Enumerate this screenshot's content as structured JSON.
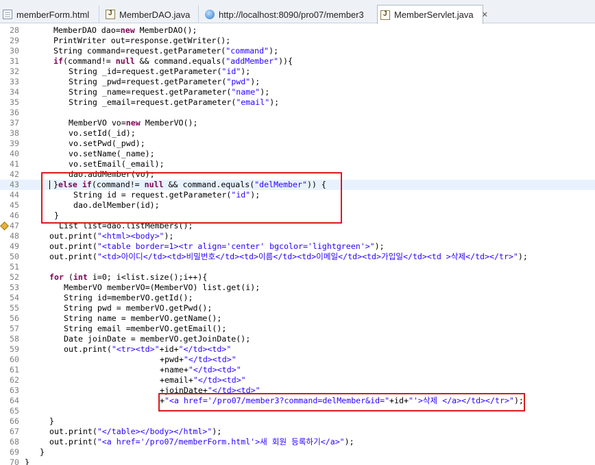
{
  "tabs": [
    {
      "label": "memberForm.html",
      "icon": "html-file-icon"
    },
    {
      "label": "MemberDAO.java",
      "icon": "java-file-icon"
    },
    {
      "label": "http://localhost:8090/pro07/member3",
      "icon": "web-browser-icon"
    },
    {
      "label": "MemberServlet.java",
      "icon": "java-file-icon",
      "active": true,
      "close": "✕"
    }
  ],
  "code_lines": [
    {
      "num": "28",
      "indent": 78,
      "tokens": [
        [
          "MemberDAO dao=",
          ""
        ],
        [
          "new",
          "kw"
        ],
        [
          " MemberDAO();",
          ""
        ]
      ]
    },
    {
      "num": "29",
      "indent": 78,
      "tokens": [
        [
          "PrintWriter out=response.getWriter();",
          ""
        ]
      ]
    },
    {
      "num": "30",
      "indent": 78,
      "tokens": [
        [
          "String command=request.getParameter(",
          ""
        ],
        [
          "\"command\"",
          "str"
        ],
        [
          ");",
          ""
        ]
      ]
    },
    {
      "num": "31",
      "indent": 78,
      "tokens": [
        [
          "if",
          "kw"
        ],
        [
          "(command!= ",
          ""
        ],
        [
          "null",
          "kw"
        ],
        [
          " && command.equals(",
          ""
        ],
        [
          "\"addMember\"",
          "str"
        ],
        [
          ")){",
          ""
        ]
      ]
    },
    {
      "num": "32",
      "indent": 100,
      "tokens": [
        [
          "String _id=request.getParameter(",
          ""
        ],
        [
          "\"id\"",
          "str"
        ],
        [
          ");",
          ""
        ]
      ]
    },
    {
      "num": "33",
      "indent": 100,
      "tokens": [
        [
          "String _pwd=request.getParameter(",
          ""
        ],
        [
          "\"pwd\"",
          "str"
        ],
        [
          ");",
          ""
        ]
      ]
    },
    {
      "num": "34",
      "indent": 100,
      "tokens": [
        [
          "String _name=request.getParameter(",
          ""
        ],
        [
          "\"name\"",
          "str"
        ],
        [
          ");",
          ""
        ]
      ]
    },
    {
      "num": "35",
      "indent": 100,
      "tokens": [
        [
          "String _email=request.getParameter(",
          ""
        ],
        [
          "\"email\"",
          "str"
        ],
        [
          ");",
          ""
        ]
      ]
    },
    {
      "num": "36",
      "indent": 100,
      "tokens": []
    },
    {
      "num": "37",
      "indent": 100,
      "tokens": [
        [
          "MemberVO vo=",
          ""
        ],
        [
          "new",
          "kw"
        ],
        [
          " MemberVO();",
          ""
        ]
      ]
    },
    {
      "num": "38",
      "indent": 100,
      "tokens": [
        [
          "vo.setId(_id);",
          ""
        ]
      ]
    },
    {
      "num": "39",
      "indent": 100,
      "tokens": [
        [
          "vo.setPwd(_pwd);",
          ""
        ]
      ]
    },
    {
      "num": "40",
      "indent": 100,
      "tokens": [
        [
          "vo.setName(_name);",
          ""
        ]
      ]
    },
    {
      "num": "41",
      "indent": 100,
      "tokens": [
        [
          "vo.setEmail(_email);",
          ""
        ]
      ]
    },
    {
      "num": "42",
      "indent": 100,
      "tokens": [
        [
          "dao.addMember(vo);",
          ""
        ]
      ]
    },
    {
      "num": "43",
      "indent": 78,
      "current": true,
      "caret": true,
      "tokens": [
        [
          "}",
          ""
        ],
        [
          "else if",
          "kw"
        ],
        [
          "(command!= ",
          ""
        ],
        [
          "null",
          "kw"
        ],
        [
          " && command.equals(",
          ""
        ],
        [
          "\"delMember\"",
          "str"
        ],
        [
          ")) {",
          ""
        ]
      ]
    },
    {
      "num": "44",
      "indent": 107,
      "tokens": [
        [
          "String id = request.getParameter(",
          ""
        ],
        [
          "\"id\"",
          "str"
        ],
        [
          ");",
          ""
        ]
      ]
    },
    {
      "num": "45",
      "indent": 107,
      "tokens": [
        [
          "dao.delMember(id);",
          ""
        ]
      ]
    },
    {
      "num": "46",
      "indent": 79,
      "tokens": [
        [
          "}",
          ""
        ]
      ]
    },
    {
      "num": "47",
      "indent": 86,
      "marker": true,
      "tokens": [
        [
          "List list=dao.listMembers();",
          ""
        ]
      ]
    },
    {
      "num": "48",
      "indent": 72,
      "tokens": [
        [
          "out.print(",
          ""
        ],
        [
          "\"<html><body>\"",
          "str"
        ],
        [
          ");",
          ""
        ]
      ]
    },
    {
      "num": "49",
      "indent": 72,
      "tokens": [
        [
          "out.print(",
          ""
        ],
        [
          "\"<table border=1><tr align='center' bgcolor='lightgreen'>\"",
          "str"
        ],
        [
          ");",
          ""
        ]
      ]
    },
    {
      "num": "50",
      "indent": 72,
      "tokens": [
        [
          "out.print(",
          ""
        ],
        [
          "\"<td>아이디</td><td>비밀번호</td><td>이름</td><td>이메일</td><td>가입일</td><td >삭제</td></tr>\"",
          "str"
        ],
        [
          ");",
          ""
        ]
      ]
    },
    {
      "num": "51",
      "indent": 72,
      "tokens": []
    },
    {
      "num": "52",
      "indent": 72,
      "tokens": [
        [
          "for",
          "kw"
        ],
        [
          " (",
          ""
        ],
        [
          "int",
          "kw"
        ],
        [
          " i=0; i<list.size();i++){",
          ""
        ]
      ]
    },
    {
      "num": "53",
      "indent": 93,
      "tokens": [
        [
          "MemberVO memberVO=(MemberVO) list.get(i);",
          ""
        ]
      ]
    },
    {
      "num": "54",
      "indent": 93,
      "tokens": [
        [
          "String id=memberVO.getId();",
          ""
        ]
      ]
    },
    {
      "num": "55",
      "indent": 93,
      "tokens": [
        [
          "String pwd = memberVO.getPwd();",
          ""
        ]
      ]
    },
    {
      "num": "56",
      "indent": 93,
      "tokens": [
        [
          "String name = memberVO.getName();",
          ""
        ]
      ]
    },
    {
      "num": "57",
      "indent": 93,
      "tokens": [
        [
          "String email =memberVO.getEmail();",
          ""
        ]
      ]
    },
    {
      "num": "58",
      "indent": 93,
      "tokens": [
        [
          "Date joinDate = memberVO.getJoinDate();",
          ""
        ]
      ]
    },
    {
      "num": "59",
      "indent": 93,
      "tokens": [
        [
          "out.print(",
          ""
        ],
        [
          "\"<tr><td>\"",
          "str"
        ],
        [
          "+id+",
          ""
        ],
        [
          "\"</td><td>\"",
          "str"
        ]
      ]
    },
    {
      "num": "60",
      "indent": 233,
      "tokens": [
        [
          "+pwd+",
          ""
        ],
        [
          "\"</td><td>\"",
          "str"
        ]
      ]
    },
    {
      "num": "61",
      "indent": 233,
      "tokens": [
        [
          "+name+",
          ""
        ],
        [
          "\"</td><td>\"",
          "str"
        ]
      ]
    },
    {
      "num": "62",
      "indent": 233,
      "tokens": [
        [
          "+email+",
          ""
        ],
        [
          "\"</td><td>\"",
          "str"
        ]
      ]
    },
    {
      "num": "63",
      "indent": 233,
      "tokens": [
        [
          "+joinDate+",
          ""
        ],
        [
          "\"</td><td>\"",
          "str"
        ]
      ]
    },
    {
      "num": "64",
      "indent": 233,
      "tokens": [
        [
          "+",
          ""
        ],
        [
          "\"<a href='/pro07/member3?command=delMember&id=\"",
          "str"
        ],
        [
          "+id+",
          ""
        ],
        [
          "\"'>삭제 </a></td></tr>\"",
          "str"
        ],
        [
          ");",
          ""
        ]
      ]
    },
    {
      "num": "65",
      "indent": 72,
      "tokens": []
    },
    {
      "num": "66",
      "indent": 72,
      "tokens": [
        [
          "}",
          ""
        ]
      ]
    },
    {
      "num": "67",
      "indent": 72,
      "tokens": [
        [
          "out.print(",
          ""
        ],
        [
          "\"</table></body></html>\"",
          "str"
        ],
        [
          ");",
          ""
        ]
      ]
    },
    {
      "num": "68",
      "indent": 72,
      "tokens": [
        [
          "out.print(",
          ""
        ],
        [
          "\"<a href='/pro07/memberForm.html'>새 회원 등록하기</a>\"",
          "str"
        ],
        [
          ");",
          ""
        ]
      ]
    },
    {
      "num": "69",
      "indent": 58,
      "tokens": [
        [
          "}",
          ""
        ]
      ]
    },
    {
      "num": "70",
      "indent": 36,
      "tokens": [
        [
          "}",
          ""
        ]
      ]
    }
  ],
  "highlights": [
    {
      "name": "delmember-branch-highlight",
      "color": "#d9191c"
    },
    {
      "name": "delete-link-highlight",
      "color": "#d9191c"
    }
  ]
}
